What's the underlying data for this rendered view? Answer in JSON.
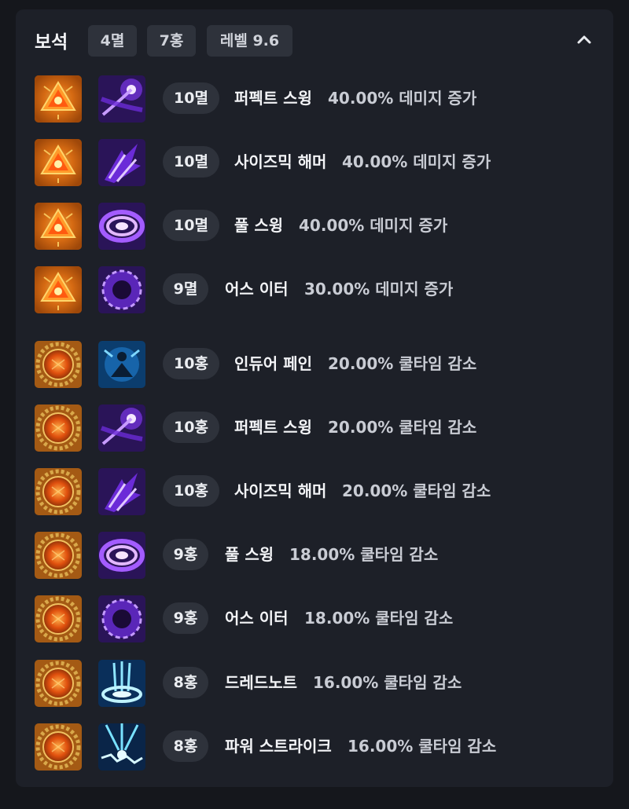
{
  "header": {
    "title": "보석",
    "pills": [
      "4멸",
      "7홍",
      "레벨 9.6"
    ],
    "collapse_icon": "chevron-up-icon"
  },
  "rows": [
    {
      "gem_type": "멸",
      "gem_icon": "annihilation-gem-icon",
      "skill_icon": "perfect-swing-icon",
      "level": "10멸",
      "skill": "퍼펙트 스윙",
      "effect": "40.00% 데미지 증가"
    },
    {
      "gem_type": "멸",
      "gem_icon": "annihilation-gem-icon",
      "skill_icon": "seismic-hammer-icon",
      "level": "10멸",
      "skill": "사이즈믹 해머",
      "effect": "40.00% 데미지 증가"
    },
    {
      "gem_type": "멸",
      "gem_icon": "annihilation-gem-icon",
      "skill_icon": "full-swing-icon",
      "level": "10멸",
      "skill": "풀 스윙",
      "effect": "40.00% 데미지 증가"
    },
    {
      "gem_type": "멸",
      "gem_icon": "annihilation-gem-icon",
      "skill_icon": "earth-eater-icon",
      "level": "9멸",
      "skill": "어스 이터",
      "effect": "30.00% 데미지 증가"
    },
    {
      "gem_type": "홍",
      "gem_icon": "crimson-gem-icon",
      "skill_icon": "endure-pain-icon",
      "level": "10홍",
      "skill": "인듀어 페인",
      "effect": "20.00% 쿨타임 감소"
    },
    {
      "gem_type": "홍",
      "gem_icon": "crimson-gem-icon",
      "skill_icon": "perfect-swing-icon",
      "level": "10홍",
      "skill": "퍼펙트 스윙",
      "effect": "20.00% 쿨타임 감소"
    },
    {
      "gem_type": "홍",
      "gem_icon": "crimson-gem-icon",
      "skill_icon": "seismic-hammer-icon",
      "level": "10홍",
      "skill": "사이즈믹 해머",
      "effect": "20.00% 쿨타임 감소"
    },
    {
      "gem_type": "홍",
      "gem_icon": "crimson-gem-icon",
      "skill_icon": "full-swing-icon",
      "level": "9홍",
      "skill": "풀 스윙",
      "effect": "18.00% 쿨타임 감소"
    },
    {
      "gem_type": "홍",
      "gem_icon": "crimson-gem-icon",
      "skill_icon": "earth-eater-icon",
      "level": "9홍",
      "skill": "어스 이터",
      "effect": "18.00% 쿨타임 감소"
    },
    {
      "gem_type": "홍",
      "gem_icon": "crimson-gem-icon",
      "skill_icon": "dreadnaught-icon",
      "level": "8홍",
      "skill": "드레드노트",
      "effect": "16.00% 쿨타임 감소"
    },
    {
      "gem_type": "홍",
      "gem_icon": "crimson-gem-icon",
      "skill_icon": "power-strike-icon",
      "level": "8홍",
      "skill": "파워 스트라이크",
      "effect": "16.00% 쿨타임 감소"
    }
  ]
}
